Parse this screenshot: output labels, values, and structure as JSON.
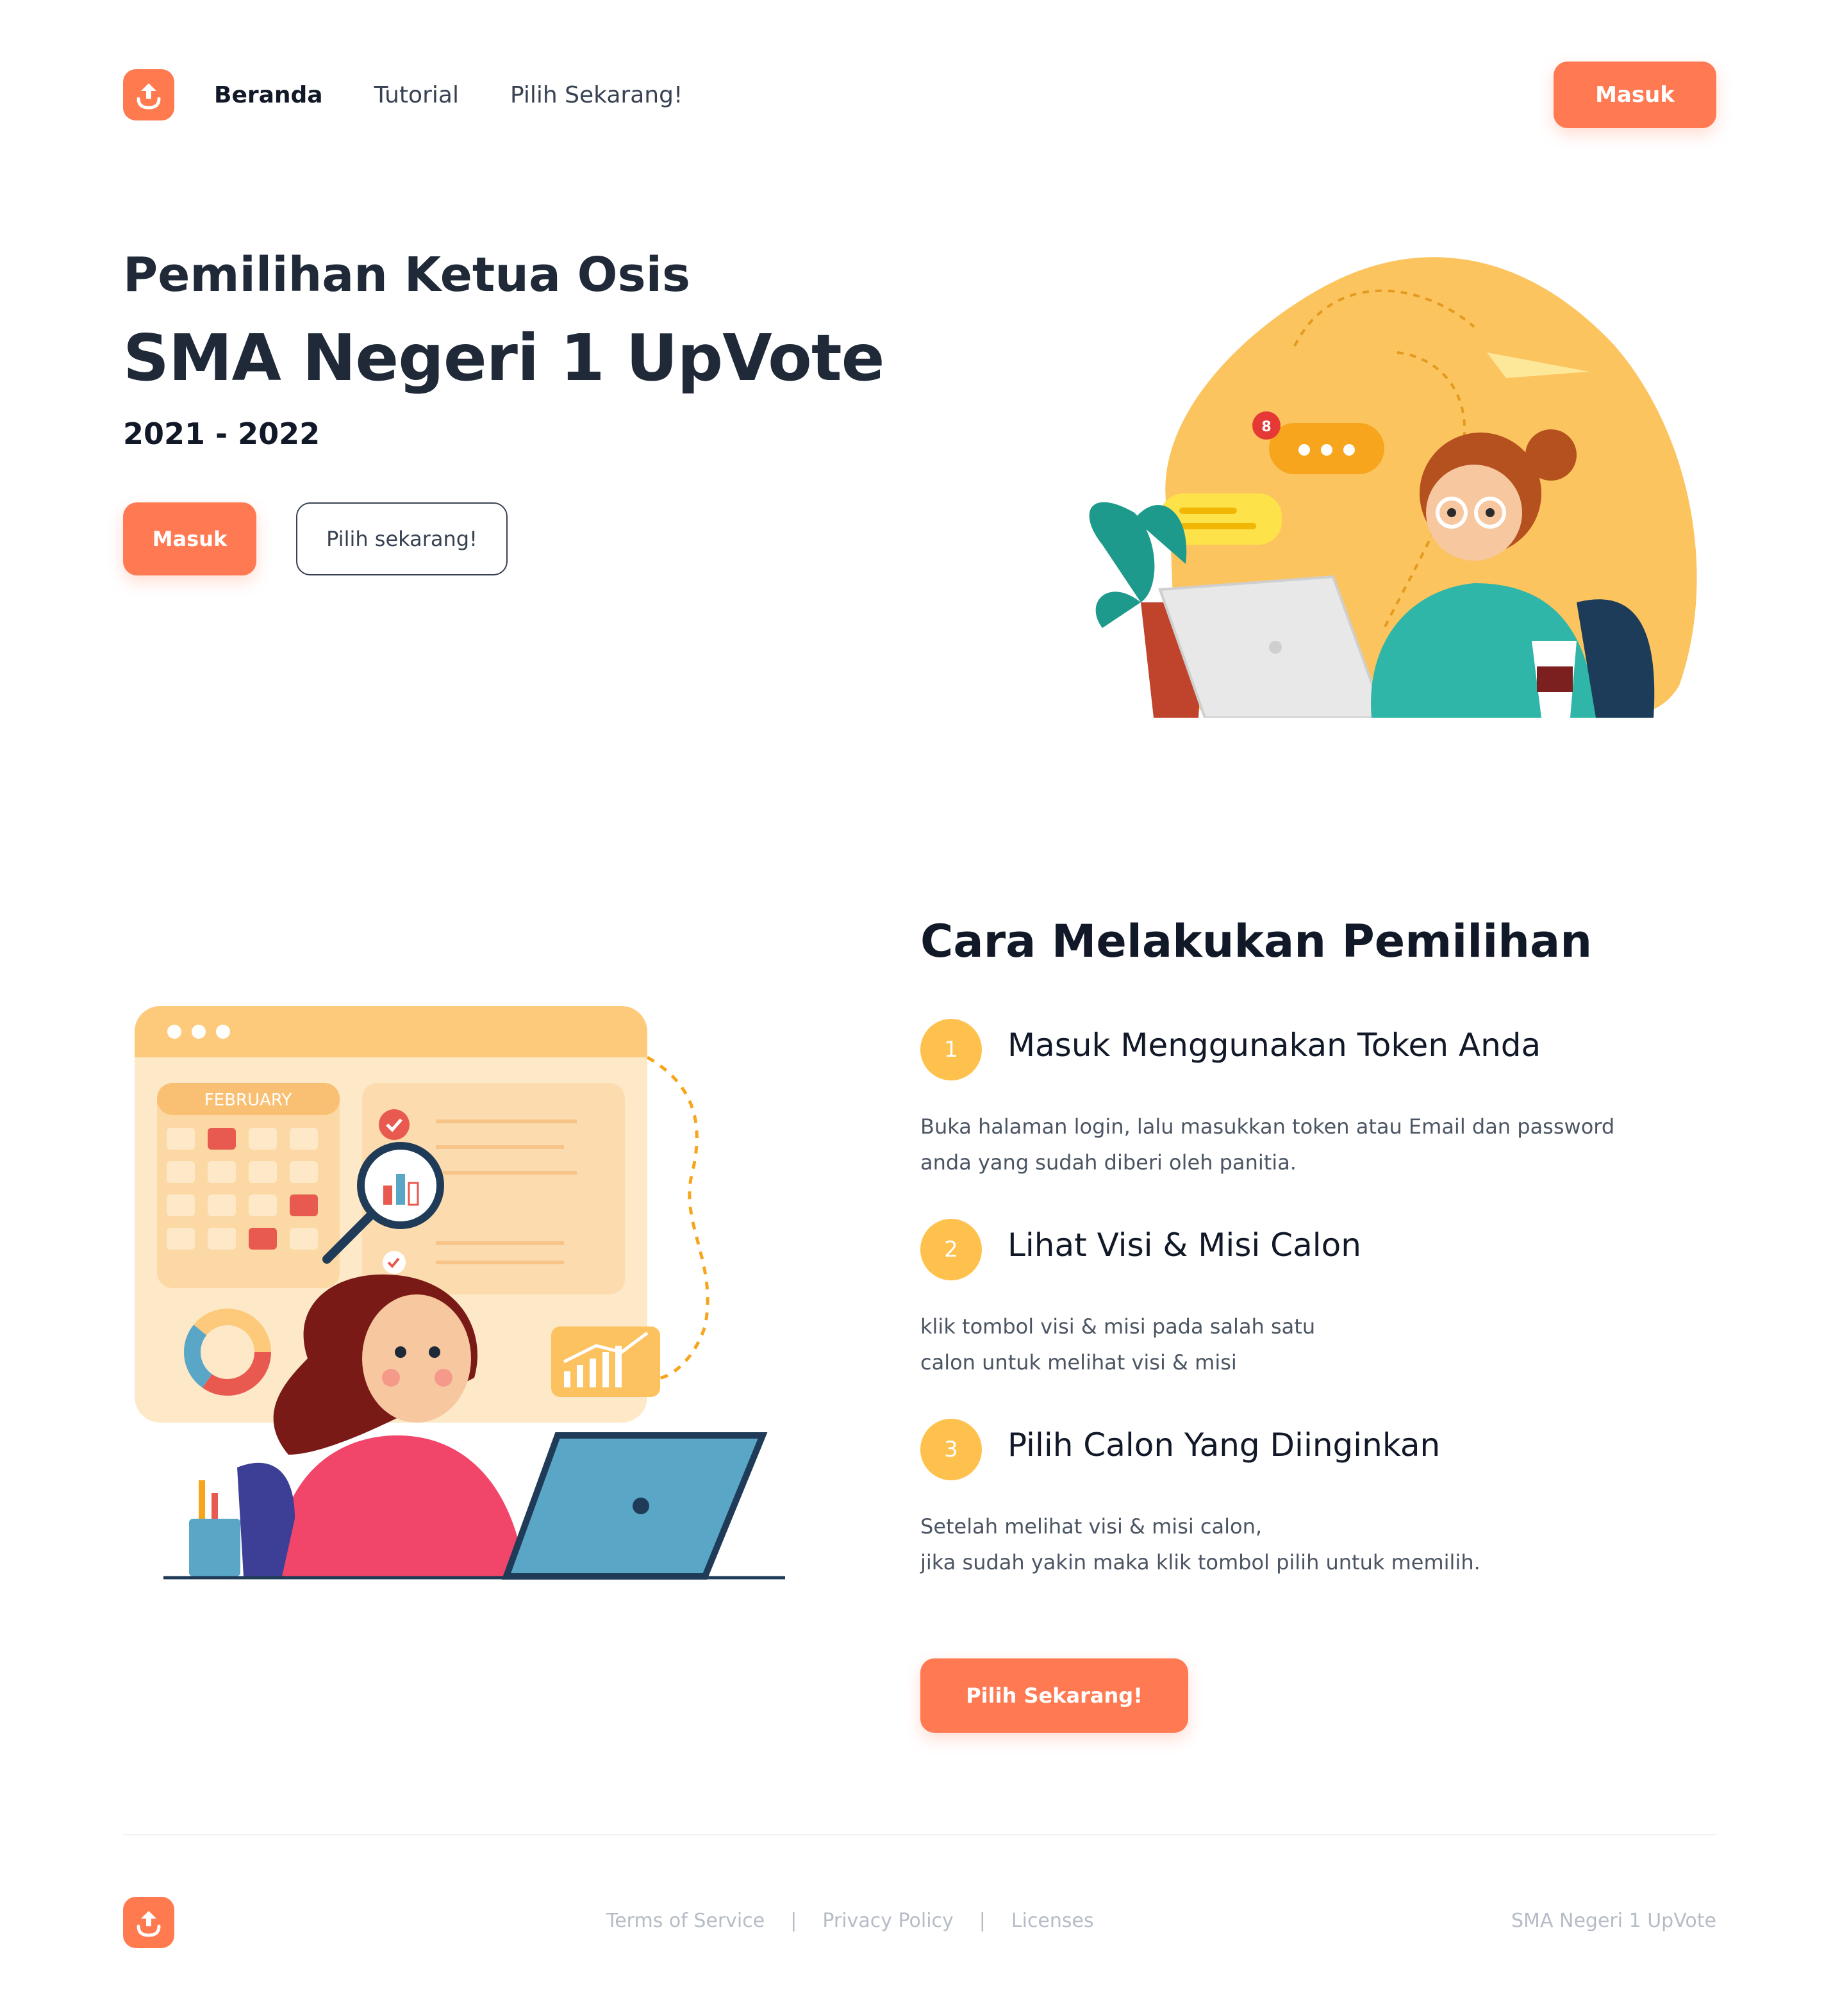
{
  "colors": {
    "accent": "#ff7a52",
    "step_badge": "#ffc14d",
    "text_dark": "#1f2937"
  },
  "nav": {
    "logo_icon": "upload-arrow-icon",
    "links": [
      "Beranda",
      "Tutorial",
      "Pilih Sekarang!"
    ],
    "login_label": "Masuk"
  },
  "hero": {
    "subtitle": "Pemilihan Ketua Osis",
    "title": "SMA Negeri 1 UpVote",
    "year": "2021 - 2022",
    "primary_button": "Masuk",
    "secondary_button": "Pilih sekarang!",
    "illustration_icon": "woman-at-laptop-illustration",
    "notification_count": "8"
  },
  "steps": {
    "illustration_icon": "woman-calendar-analytics-illustration",
    "calendar_month": "FEBRUARY",
    "title": "Cara Melakukan Pemilihan",
    "items": [
      {
        "number": "1",
        "title": "Masuk Menggunakan Token Anda",
        "desc_line1": "Buka halaman login, lalu masukkan token atau Email dan password",
        "desc_line2": "anda yang sudah diberi oleh panitia."
      },
      {
        "number": "2",
        "title": "Lihat Visi & Misi Calon",
        "desc_line1": "klik tombol visi & misi pada salah satu",
        "desc_line2": "calon untuk melihat visi & misi"
      },
      {
        "number": "3",
        "title": "Pilih Calon Yang Diinginkan",
        "desc_line1": "Setelah melihat visi & misi calon,",
        "desc_line2": "jika sudah yakin maka klik tombol pilih untuk memilih."
      }
    ],
    "cta_button": "Pilih Sekarang!"
  },
  "footer": {
    "links": [
      "Terms of Service",
      "Privacy Policy",
      "Licenses"
    ],
    "separator": "|",
    "brand": "SMA Negeri 1 UpVote"
  }
}
